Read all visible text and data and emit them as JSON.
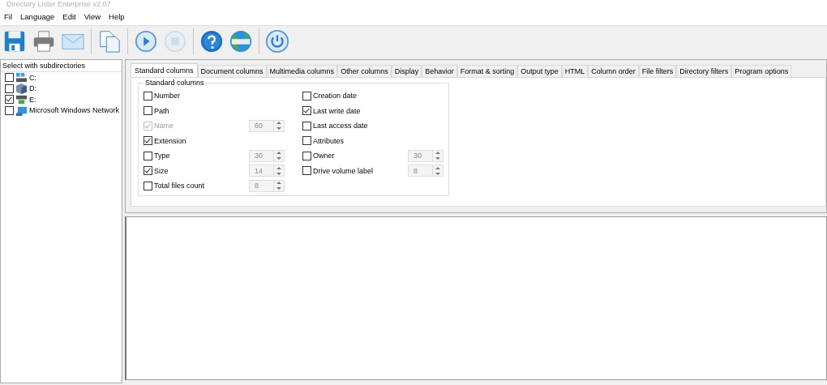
{
  "window": {
    "title": "Directory Lister Enterprise v2.07"
  },
  "menu": [
    "Fil",
    "Language",
    "Edit",
    "View",
    "Help"
  ],
  "toolbar": [
    [
      {
        "kind": "save",
        "disabled": false
      },
      {
        "kind": "print",
        "disabled": false
      },
      {
        "kind": "mail",
        "disabled": false
      }
    ],
    [
      {
        "kind": "copy",
        "disabled": false
      }
    ],
    [
      {
        "kind": "play",
        "disabled": false
      },
      {
        "kind": "stop",
        "disabled": true
      }
    ],
    [
      {
        "kind": "help",
        "disabled": false
      },
      {
        "kind": "web",
        "disabled": false
      }
    ],
    [
      {
        "kind": "power",
        "disabled": false
      }
    ]
  ],
  "tree": {
    "header": "Select with subdirectories",
    "items": [
      {
        "label": "C:",
        "kind": "drive",
        "checked": false
      },
      {
        "label": "D:",
        "kind": "disc",
        "checked": false
      },
      {
        "label": "E:",
        "kind": "usb",
        "checked": true
      },
      {
        "label": "Microsoft Windows Network",
        "kind": "network",
        "checked": false
      }
    ]
  },
  "tabs": [
    {
      "label": "Standard columns",
      "selected": true
    },
    {
      "label": "Document columns",
      "selected": false
    },
    {
      "label": "Multimedia columns",
      "selected": false
    },
    {
      "label": "Other columns",
      "selected": false
    },
    {
      "label": "Display",
      "selected": false
    },
    {
      "label": "Behavior",
      "selected": false
    },
    {
      "label": "Format & sorting",
      "selected": false
    },
    {
      "label": "Output type",
      "selected": false
    },
    {
      "label": "HTML",
      "selected": false
    },
    {
      "label": "Column order",
      "selected": false
    },
    {
      "label": "File filters",
      "selected": false
    },
    {
      "label": "Directory filters",
      "selected": false
    },
    {
      "label": "Program options",
      "selected": false
    }
  ],
  "group": {
    "title": "Standard columns",
    "columns": [
      [
        {
          "label": "Number",
          "checked": false,
          "disabled": false
        },
        {
          "label": "Path",
          "checked": false,
          "disabled": false
        },
        {
          "label": "Name",
          "checked": true,
          "disabled": true,
          "spin": {
            "value": "60",
            "disabled": true
          }
        },
        {
          "label": "Extension",
          "checked": true,
          "disabled": false
        },
        {
          "label": "Type",
          "checked": false,
          "disabled": false,
          "spin": {
            "value": "30",
            "disabled": true
          }
        },
        {
          "label": "Size",
          "checked": true,
          "disabled": false,
          "spin": {
            "value": "14",
            "disabled": true
          }
        },
        {
          "label": "Total files count",
          "checked": false,
          "disabled": false,
          "spin": {
            "value": "8",
            "disabled": true
          }
        }
      ],
      [
        {
          "label": "Creation date",
          "checked": false,
          "disabled": false
        },
        {
          "label": "Last write date",
          "checked": true,
          "disabled": false
        },
        {
          "label": "Last access date",
          "checked": false,
          "disabled": false
        },
        {
          "label": "Attributes",
          "checked": false,
          "disabled": false
        },
        {
          "label": "Owner",
          "checked": false,
          "disabled": false,
          "spin": {
            "value": "30",
            "disabled": true
          }
        },
        {
          "label": "Drive volume label",
          "checked": false,
          "disabled": false,
          "spin": {
            "value": "8",
            "disabled": true
          }
        }
      ]
    ]
  }
}
